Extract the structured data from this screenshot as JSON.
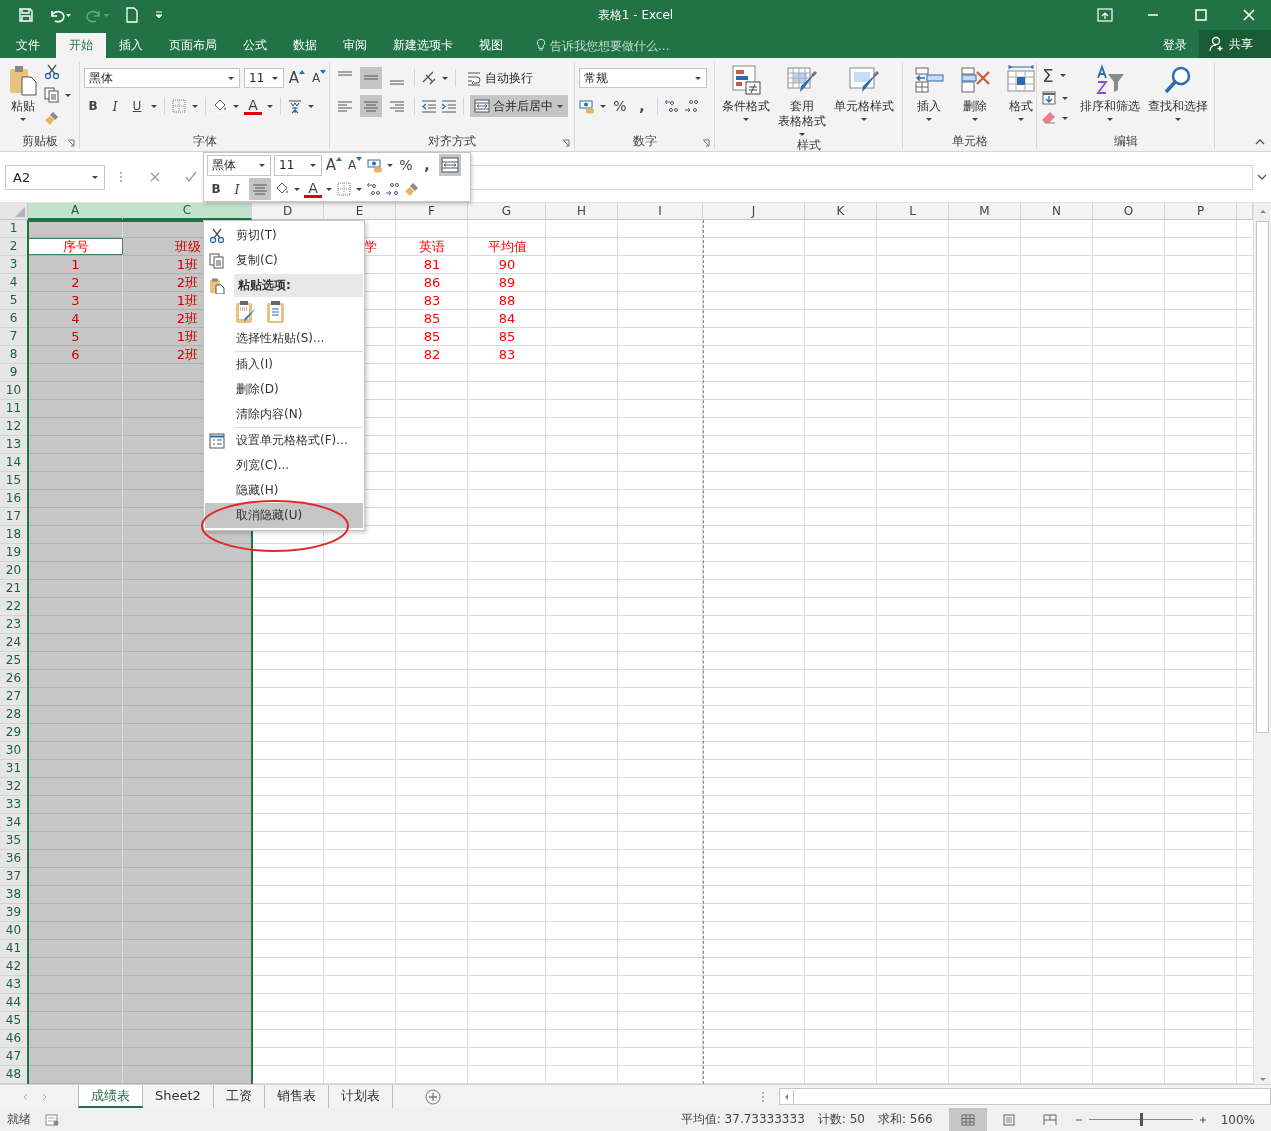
{
  "window": {
    "title": "表格1 - Excel"
  },
  "ribbon_tabs": [
    {
      "label": "文件",
      "selected": false
    },
    {
      "label": "开始",
      "selected": true
    },
    {
      "label": "插入",
      "selected": false
    },
    {
      "label": "页面布局",
      "selected": false
    },
    {
      "label": "公式",
      "selected": false
    },
    {
      "label": "数据",
      "selected": false
    },
    {
      "label": "审阅",
      "selected": false
    },
    {
      "label": "新建选项卡",
      "selected": false
    },
    {
      "label": "视图",
      "selected": false
    }
  ],
  "tell_me": {
    "placeholder": "告诉我您想要做什么..."
  },
  "account": {
    "sign_in": "登录",
    "share": "共享"
  },
  "clipboard": {
    "paste": "粘贴",
    "label": "剪贴板"
  },
  "font": {
    "name": "黑体",
    "size": "11",
    "grow": "A",
    "shrink": "A",
    "bold": "B",
    "italic": "I",
    "underline": "U",
    "font_color": "A",
    "label": "字体"
  },
  "alignment": {
    "vertical": [
      {
        "kind": "top",
        "selected": false
      },
      {
        "kind": "middle",
        "selected": true
      },
      {
        "kind": "bottom",
        "selected": false
      }
    ],
    "horizontal": [
      {
        "kind": "left",
        "selected": false
      },
      {
        "kind": "center",
        "selected": true
      },
      {
        "kind": "right",
        "selected": false
      }
    ],
    "wrap": "自动换行",
    "merge": {
      "label": "合并后居中",
      "on": true
    },
    "label": "对齐方式"
  },
  "number": {
    "format": "常规",
    "percent": "%",
    "comma": ",",
    "label": "数字"
  },
  "styles": {
    "buttons": [
      {
        "kind": "conditional",
        "lines": [
          "条件格式"
        ]
      },
      {
        "kind": "table",
        "lines": [
          "套用",
          "表格格式"
        ]
      },
      {
        "kind": "cell",
        "lines": [
          "单元格样式"
        ]
      }
    ],
    "label": "样式"
  },
  "cells": {
    "buttons": [
      {
        "kind": "insert",
        "label": "插入"
      },
      {
        "kind": "delete",
        "label": "删除"
      },
      {
        "kind": "format",
        "label": "格式"
      }
    ],
    "label": "单元格"
  },
  "editing": {
    "sum": "Σ",
    "buttons": [
      {
        "kind": "sort",
        "label": "排序和筛选"
      },
      {
        "kind": "find",
        "label": "查找和选择"
      }
    ],
    "label": "编辑"
  },
  "formula_bar": {
    "name_box": "A2"
  },
  "mini_toolbar": {
    "font": "黑体",
    "size": "11",
    "grow": "A",
    "shrink": "A",
    "percent": "%",
    "comma": ",",
    "bold": "B",
    "italic": "I",
    "font_color": "A",
    "center_on": true,
    "merge_on": true
  },
  "sheet": {
    "columns": [
      {
        "label": "A",
        "selected": true
      },
      {
        "label": "C",
        "selected": true
      },
      {
        "label": "D",
        "selected": false
      },
      {
        "label": "E",
        "selected": false
      },
      {
        "label": "F",
        "selected": false
      },
      {
        "label": "G",
        "selected": false
      },
      {
        "label": "H",
        "selected": false
      },
      {
        "label": "I",
        "selected": false
      },
      {
        "label": "J",
        "selected": false
      },
      {
        "label": "K",
        "selected": false
      },
      {
        "label": "L",
        "selected": false
      },
      {
        "label": "M",
        "selected": false
      },
      {
        "label": "N",
        "selected": false
      },
      {
        "label": "O",
        "selected": false
      },
      {
        "label": "P",
        "selected": false
      }
    ],
    "rows": [
      {
        "number": "1"
      },
      {
        "number": "2",
        "cells": [
          {
            "text": "序号",
            "active": true
          },
          {
            "text": "班级",
            "active": false
          },
          null,
          {
            "text": "学",
            "active": false
          },
          {
            "text": "英语",
            "active": false
          },
          {
            "text": "平均值",
            "active": false
          }
        ]
      },
      {
        "number": "3",
        "cells": [
          {
            "text": "1",
            "active": false
          },
          {
            "text": "1班",
            "active": false
          },
          null,
          null,
          {
            "text": "81",
            "active": false
          },
          {
            "text": "90",
            "active": false
          }
        ]
      },
      {
        "number": "4",
        "cells": [
          {
            "text": "2",
            "active": false
          },
          {
            "text": "2班",
            "active": false
          },
          null,
          null,
          {
            "text": "86",
            "active": false
          },
          {
            "text": "89",
            "active": false
          }
        ]
      },
      {
        "number": "5",
        "cells": [
          {
            "text": "3",
            "active": false
          },
          {
            "text": "1班",
            "active": false
          },
          null,
          null,
          {
            "text": "83",
            "active": false
          },
          {
            "text": "88",
            "active": false
          }
        ]
      },
      {
        "number": "6",
        "cells": [
          {
            "text": "4",
            "active": false
          },
          {
            "text": "2班",
            "active": false
          },
          null,
          null,
          {
            "text": "85",
            "active": false
          },
          {
            "text": "84",
            "active": false
          }
        ]
      },
      {
        "number": "7",
        "cells": [
          {
            "text": "5",
            "active": false
          },
          {
            "text": "1班",
            "active": false
          },
          null,
          null,
          {
            "text": "85",
            "active": false
          },
          {
            "text": "85",
            "active": false
          }
        ]
      },
      {
        "number": "8",
        "cells": [
          {
            "text": "6",
            "active": false
          },
          {
            "text": "2班",
            "active": false
          },
          null,
          null,
          {
            "text": "82",
            "active": false
          },
          {
            "text": "83",
            "active": false
          }
        ]
      },
      {
        "number": "9"
      },
      {
        "number": "10"
      },
      {
        "number": "11"
      },
      {
        "number": "12"
      },
      {
        "number": "13"
      },
      {
        "number": "14"
      },
      {
        "number": "15"
      },
      {
        "number": "16"
      },
      {
        "number": "17"
      },
      {
        "number": "18"
      },
      {
        "number": "19"
      },
      {
        "number": "20"
      },
      {
        "number": "21"
      },
      {
        "number": "22"
      },
      {
        "number": "23"
      },
      {
        "number": "24"
      },
      {
        "number": "25"
      },
      {
        "number": "26"
      },
      {
        "number": "27"
      },
      {
        "number": "28"
      },
      {
        "number": "29"
      },
      {
        "number": "30"
      },
      {
        "number": "31"
      },
      {
        "number": "32"
      },
      {
        "number": "33"
      },
      {
        "number": "34"
      },
      {
        "number": "35"
      },
      {
        "number": "36"
      },
      {
        "number": "37"
      },
      {
        "number": "38"
      },
      {
        "number": "39"
      },
      {
        "number": "40"
      },
      {
        "number": "41"
      },
      {
        "number": "42"
      },
      {
        "number": "43"
      },
      {
        "number": "44"
      },
      {
        "number": "45"
      },
      {
        "number": "46"
      },
      {
        "number": "47"
      },
      {
        "number": "48"
      }
    ]
  },
  "context_menu": {
    "items": [
      {
        "kind": "cut",
        "label": "剪切(T)",
        "selected": false
      },
      {
        "kind": "copy",
        "label": "复制(C)",
        "selected": false
      },
      {
        "kind": "paste_heading",
        "label": "粘贴选项:"
      },
      {
        "kind": "paste_options"
      },
      {
        "kind": "command",
        "label": "选择性粘贴(S)...",
        "selected": false
      },
      {
        "kind": "separator"
      },
      {
        "kind": "command",
        "label": "插入(I)",
        "selected": false
      },
      {
        "kind": "command",
        "label": "删除(D)",
        "selected": false
      },
      {
        "kind": "command",
        "label": "清除内容(N)",
        "selected": false
      },
      {
        "kind": "separator"
      },
      {
        "kind": "format_cells",
        "label": "设置单元格格式(F)...",
        "selected": false
      },
      {
        "kind": "command",
        "label": "列宽(C)...",
        "selected": false
      },
      {
        "kind": "command",
        "label": "隐藏(H)",
        "selected": false
      },
      {
        "kind": "command",
        "label": "取消隐藏(U)",
        "selected": true
      }
    ]
  },
  "sheet_tabs": [
    {
      "label": "成绩表",
      "selected": true
    },
    {
      "label": "Sheet2",
      "selected": false
    },
    {
      "label": "工资",
      "selected": false
    },
    {
      "label": "销售表",
      "selected": false
    },
    {
      "label": "计划表",
      "selected": false
    }
  ],
  "status_bar": {
    "ready": "就绪",
    "average": "平均值: 37.73333333",
    "count": "计数: 50",
    "sum": "求和: 566",
    "views": [
      {
        "kind": "normal",
        "selected": true
      },
      {
        "kind": "page_layout",
        "selected": false
      },
      {
        "kind": "page_break",
        "selected": false
      }
    ],
    "zoom": {
      "level": 0.5,
      "reading": "100%"
    }
  }
}
